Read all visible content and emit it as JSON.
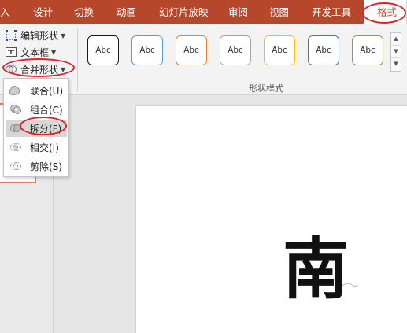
{
  "ribbon_tabs": [
    {
      "label": "入"
    },
    {
      "label": "设计"
    },
    {
      "label": "切换"
    },
    {
      "label": "动画"
    },
    {
      "label": "幻灯片放映"
    },
    {
      "label": "审阅"
    },
    {
      "label": "视图"
    },
    {
      "label": "开发工具"
    },
    {
      "label": "格式"
    }
  ],
  "active_tab": "格式",
  "insert_shapes": {
    "edit_shape": "编辑形状",
    "text_box": "文本框",
    "merge_shapes": "合并形状"
  },
  "shape_styles": {
    "group_label": "形状样式",
    "presets": [
      {
        "label": "Abc",
        "border": "#1a1a1a"
      },
      {
        "label": "Abc",
        "border": "#5b9bd5"
      },
      {
        "label": "Abc",
        "border": "#ed7d31"
      },
      {
        "label": "Abc",
        "border": "#a5a5a5"
      },
      {
        "label": "Abc",
        "border": "#ffc000"
      },
      {
        "label": "Abc",
        "border": "#4472c4"
      },
      {
        "label": "Abc",
        "border": "#70ad47"
      }
    ]
  },
  "merge_menu": {
    "items": [
      {
        "label": "联合(U)",
        "icon": "union-icon"
      },
      {
        "label": "组合(C)",
        "icon": "combine-icon"
      },
      {
        "label": "拆分(F)",
        "icon": "fragment-icon",
        "highlighted": true
      },
      {
        "label": "相交(I)",
        "icon": "intersect-icon"
      },
      {
        "label": "剪除(S)",
        "icon": "subtract-icon"
      }
    ]
  },
  "slide": {
    "glyph": "南"
  },
  "colors": {
    "ribbon_accent": "#b7472a",
    "annotation": "#d9242a"
  }
}
